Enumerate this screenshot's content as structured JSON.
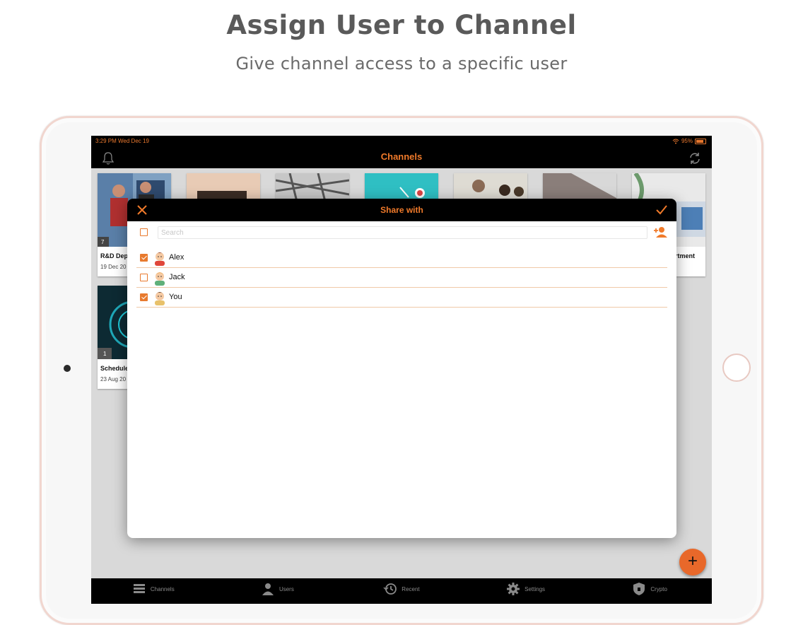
{
  "promo": {
    "title": "Assign User to Channel",
    "subtitle": "Give channel access to a specific user"
  },
  "status_bar": {
    "time_date": "3:29 PM   Wed Dec 19",
    "battery": "95%",
    "battery_level": 0.95
  },
  "nav": {
    "title": "Channels",
    "left_icon": "bell-icon",
    "right_icon": "refresh-icon"
  },
  "channels": [
    {
      "title": "R&D Dep",
      "date": "19 Dec 20",
      "badge": "7"
    },
    {
      "title": "",
      "date": ""
    },
    {
      "title": "",
      "date": ""
    },
    {
      "title": "",
      "date": ""
    },
    {
      "title": "",
      "date": ""
    },
    {
      "title": "",
      "date": ""
    },
    {
      "title": "artment",
      "date": ""
    },
    {
      "title": "Schedule",
      "date": "23 Aug 20",
      "badge": "1"
    }
  ],
  "share_dialog": {
    "title": "Share with",
    "close_icon": "close-icon",
    "confirm_icon": "checkmark-icon",
    "select_all_checked": false,
    "search_placeholder": "Search",
    "search_value": "",
    "add_user_icon": "add-user-icon",
    "users": [
      {
        "name": "Alex",
        "checked": true
      },
      {
        "name": "Jack",
        "checked": false
      },
      {
        "name": "You",
        "checked": true
      }
    ]
  },
  "fab": {
    "label": "+"
  },
  "tabs": [
    {
      "label": "Channels",
      "icon": "channels-icon"
    },
    {
      "label": "Users",
      "icon": "user-icon"
    },
    {
      "label": "Recent",
      "icon": "history-icon"
    },
    {
      "label": "Settings",
      "icon": "gear-icon"
    },
    {
      "label": "Crypto",
      "icon": "shield-icon"
    }
  ],
  "colors": {
    "accent": "#f07a2a",
    "background": "#ffffff",
    "bar": "#000000"
  }
}
